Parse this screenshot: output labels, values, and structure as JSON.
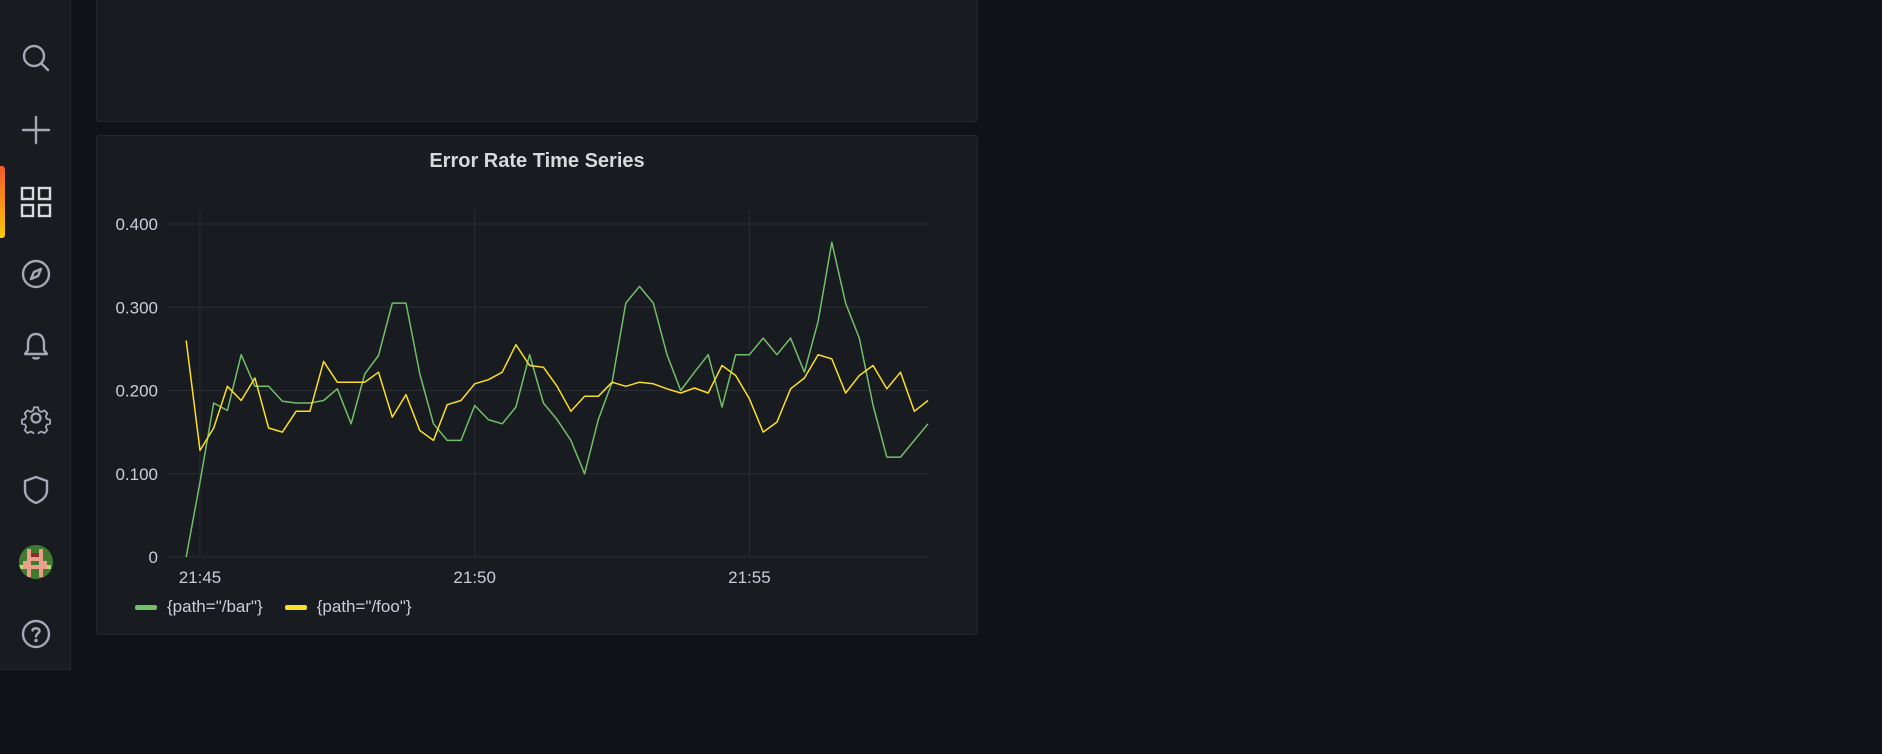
{
  "colors": {
    "background": "#111217",
    "panel": "#181b1f",
    "series_bar": "#73bf69",
    "series_foo": "#fade2a",
    "icon": "#a7a7b8"
  },
  "sidebar": {
    "items": [
      {
        "icon": "search-icon"
      },
      {
        "icon": "plus-icon"
      },
      {
        "icon": "dashboards-icon",
        "active": true
      },
      {
        "icon": "compass-icon"
      },
      {
        "icon": "bell-icon"
      },
      {
        "icon": "gear-icon"
      },
      {
        "icon": "shield-icon"
      },
      {
        "icon": "avatar"
      },
      {
        "icon": "help-icon"
      }
    ]
  },
  "panel": {
    "title": "Error Rate Time Series"
  },
  "chart_data": {
    "type": "line",
    "title": "Error Rate Time Series",
    "xlabel": "",
    "ylabel": "",
    "ylim": [
      0,
      0.4
    ],
    "xlim": [
      "21:44:24",
      "21:58:15"
    ],
    "y_ticks": [
      "0",
      "0.100",
      "0.200",
      "0.300",
      "0.400"
    ],
    "x_ticks": [
      "21:45",
      "21:50",
      "21:55"
    ],
    "grid": true,
    "legend_position": "bottom-left",
    "x": [
      "21:44:45",
      "21:45:00",
      "21:45:15",
      "21:45:30",
      "21:45:45",
      "21:46:00",
      "21:46:15",
      "21:46:30",
      "21:46:45",
      "21:47:00",
      "21:47:15",
      "21:47:30",
      "21:47:45",
      "21:48:00",
      "21:48:15",
      "21:48:30",
      "21:48:45",
      "21:49:00",
      "21:49:15",
      "21:49:30",
      "21:49:45",
      "21:50:00",
      "21:50:15",
      "21:50:30",
      "21:50:45",
      "21:51:00",
      "21:51:15",
      "21:51:30",
      "21:51:45",
      "21:52:00",
      "21:52:15",
      "21:52:30",
      "21:52:45",
      "21:53:00",
      "21:53:15",
      "21:53:30",
      "21:53:45",
      "21:54:00",
      "21:54:15",
      "21:54:30",
      "21:54:45",
      "21:55:00",
      "21:55:15",
      "21:55:30",
      "21:55:45",
      "21:56:00",
      "21:56:15",
      "21:56:30",
      "21:56:45",
      "21:57:00",
      "21:57:15",
      "21:57:30",
      "21:57:45",
      "21:58:00",
      "21:58:15"
    ],
    "series": [
      {
        "name": "{path=\"/bar\"}",
        "color": "#73bf69",
        "values": [
          0,
          0.09,
          0.185,
          0.176,
          0.243,
          0.205,
          0.205,
          0.187,
          0.185,
          0.185,
          0.188,
          0.202,
          0.16,
          0.22,
          0.242,
          0.305,
          0.305,
          0.22,
          0.16,
          0.14,
          0.14,
          0.182,
          0.165,
          0.16,
          0.18,
          0.243,
          0.185,
          0.165,
          0.14,
          0.1,
          0.165,
          0.21,
          0.305,
          0.325,
          0.305,
          0.243,
          0.2,
          0.222,
          0.243,
          0.18,
          0.243,
          0.243,
          0.263,
          0.243,
          0.263,
          0.222,
          0.283,
          0.378,
          0.305,
          0.263,
          0.182,
          0.12,
          0.12,
          0.14,
          0.16
        ]
      },
      {
        "name": "{path=\"/foo\"}",
        "color": "#fade2a",
        "values": [
          0.26,
          0.128,
          0.155,
          0.205,
          0.188,
          0.215,
          0.155,
          0.15,
          0.175,
          0.175,
          0.235,
          0.21,
          0.21,
          0.21,
          0.222,
          0.168,
          0.195,
          0.152,
          0.14,
          0.183,
          0.188,
          0.208,
          0.213,
          0.222,
          0.255,
          0.23,
          0.228,
          0.205,
          0.175,
          0.193,
          0.193,
          0.21,
          0.205,
          0.21,
          0.208,
          0.202,
          0.197,
          0.203,
          0.197,
          0.23,
          0.218,
          0.19,
          0.15,
          0.162,
          0.202,
          0.215,
          0.243,
          0.238,
          0.197,
          0.218,
          0.23,
          0.202,
          0.222,
          0.175,
          0.188
        ]
      }
    ]
  }
}
